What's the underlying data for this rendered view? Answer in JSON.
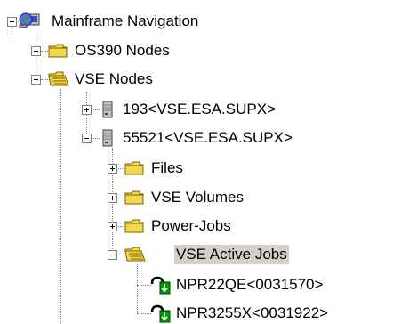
{
  "tree": {
    "root": {
      "label": "Mainframe Navigation",
      "icon": "network-globe-icon"
    },
    "os390": {
      "label": "OS390 Nodes",
      "icon": "folder-closed-icon"
    },
    "vse": {
      "label": "VSE Nodes",
      "icon": "folder-open-icon"
    },
    "node193": {
      "label": "193<VSE.ESA.SUPX>",
      "icon": "server-icon"
    },
    "node55521": {
      "label": "55521<VSE.ESA.SUPX>",
      "icon": "server-icon"
    },
    "files": {
      "label": "Files",
      "icon": "folder-closed-icon"
    },
    "volumes": {
      "label": "VSE Volumes",
      "icon": "folder-closed-icon"
    },
    "powerjobs": {
      "label": "Power-Jobs",
      "icon": "folder-closed-icon"
    },
    "activejobs": {
      "label": "VSE Active Jobs",
      "icon": "folder-open-icon"
    },
    "job1": {
      "label": "NPR22QE<0031570>",
      "icon": "active-job-icon"
    },
    "job2": {
      "label": "NPR3255X<0031922>",
      "icon": "active-job-icon"
    }
  },
  "colors": {
    "folder": "#f0d84a",
    "selection": "#d4d0c8",
    "job_accent": "#00a000",
    "tree_lines": "#808080"
  }
}
